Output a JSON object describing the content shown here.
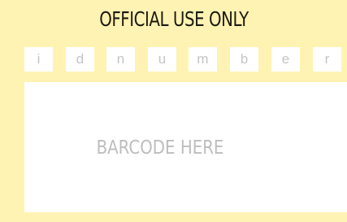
{
  "form": {
    "title": "OFFICIAL USE ONLY",
    "id_number_boxes": [
      "i",
      "d",
      "n",
      "u",
      "m",
      "b",
      "e",
      "r"
    ],
    "barcode_placeholder": "BARCODE HERE"
  },
  "colors": {
    "background": "#fff3b3",
    "panel": "#ffeb80",
    "title_text": "#1c1a10",
    "field_bg": "#ffffff",
    "placeholder_text": "#bdbdbd"
  }
}
